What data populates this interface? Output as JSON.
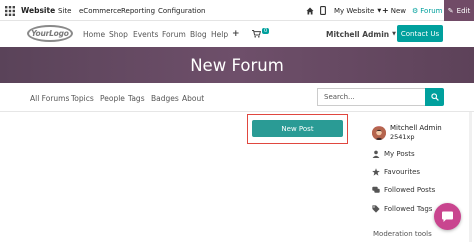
{
  "topbar": {
    "brand": "Website",
    "menu": [
      "Site",
      "eCommerce",
      "Reporting",
      "Configuration"
    ],
    "website_select": "My Website",
    "new_label": "New",
    "forum_label": "Forum",
    "edit_label": "Edit"
  },
  "navbar": {
    "logo_text": "YourLogo",
    "links": [
      "Home",
      "Shop",
      "Events",
      "Forum",
      "Blog",
      "Help"
    ],
    "cart_count": "0",
    "user": "Mitchell Admin",
    "contact_label": "Contact Us"
  },
  "hero": {
    "title": "New Forum"
  },
  "subnav": {
    "links": [
      "All Forums",
      "Topics",
      "People",
      "Tags",
      "Badges",
      "About"
    ],
    "search_placeholder": "Search..."
  },
  "main": {
    "new_post_label": "New Post"
  },
  "sidebar": {
    "user_name": "Mitchell Admin",
    "user_xp": "2541xp",
    "items": [
      "My Posts",
      "Favourites",
      "Followed Posts",
      "Followed Tags"
    ],
    "moderation_label": "Moderation tools"
  },
  "colors": {
    "accent": "#00a09d",
    "brand_purple": "#714b67",
    "hero": "#5d4259",
    "chat": "#c9458f",
    "highlight": "#e0473f"
  }
}
